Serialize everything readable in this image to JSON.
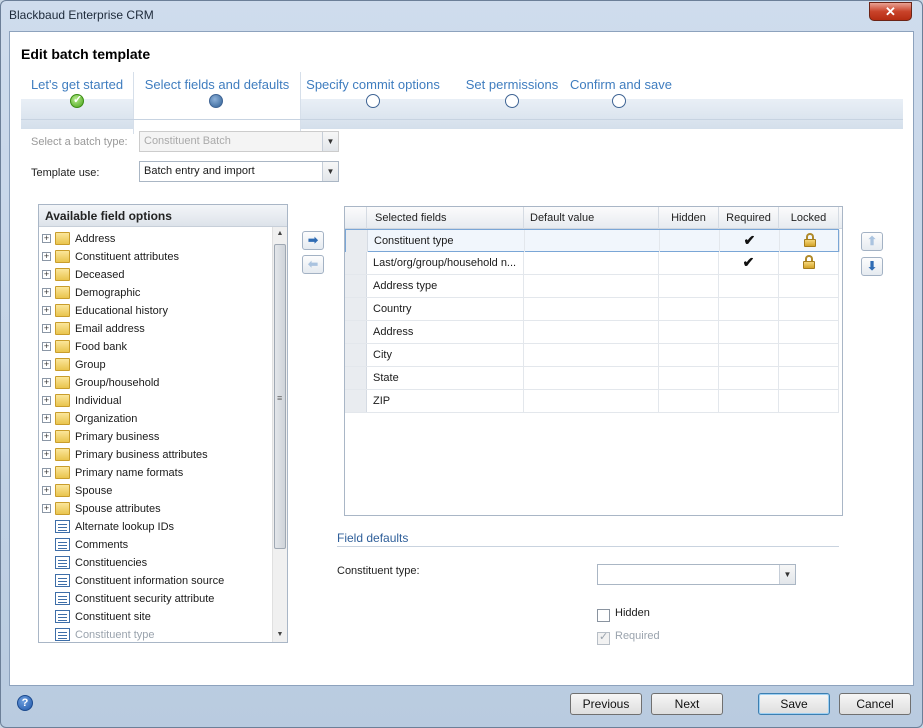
{
  "window": {
    "title": "Blackbaud Enterprise CRM",
    "close_glyph": "✕"
  },
  "page": {
    "heading": "Edit batch template"
  },
  "wizard": {
    "steps": [
      {
        "label": "Let's get started",
        "state": "done"
      },
      {
        "label": "Select fields and defaults",
        "state": "current"
      },
      {
        "label": "Specify commit options",
        "state": "pending"
      },
      {
        "label": "Set permissions",
        "state": "pending"
      },
      {
        "label": "Confirm and save",
        "state": "pending"
      }
    ]
  },
  "form": {
    "batch_type_label": "Select a batch type:",
    "batch_type_value": "Constituent Batch",
    "template_use_label": "Template use:",
    "template_use_value": "Batch entry and import"
  },
  "tree": {
    "header": "Available field options",
    "items": [
      {
        "label": "Address",
        "type": "folder"
      },
      {
        "label": "Constituent attributes",
        "type": "folder"
      },
      {
        "label": "Deceased",
        "type": "folder"
      },
      {
        "label": "Demographic",
        "type": "folder"
      },
      {
        "label": "Educational history",
        "type": "folder"
      },
      {
        "label": "Email address",
        "type": "folder"
      },
      {
        "label": "Food bank",
        "type": "folder"
      },
      {
        "label": "Group",
        "type": "folder"
      },
      {
        "label": "Group/household",
        "type": "folder"
      },
      {
        "label": "Individual",
        "type": "folder"
      },
      {
        "label": "Organization",
        "type": "folder"
      },
      {
        "label": "Primary business",
        "type": "folder"
      },
      {
        "label": "Primary business attributes",
        "type": "folder"
      },
      {
        "label": "Primary name formats",
        "type": "folder"
      },
      {
        "label": "Spouse",
        "type": "folder"
      },
      {
        "label": "Spouse attributes",
        "type": "folder"
      },
      {
        "label": "Alternate lookup IDs",
        "type": "field"
      },
      {
        "label": "Comments",
        "type": "field"
      },
      {
        "label": "Constituencies",
        "type": "field"
      },
      {
        "label": "Constituent information source",
        "type": "field"
      },
      {
        "label": "Constituent security attribute",
        "type": "field"
      },
      {
        "label": "Constituent site",
        "type": "field"
      },
      {
        "label": "Constituent type",
        "type": "field-faded"
      }
    ]
  },
  "grid": {
    "columns": [
      "Selected fields",
      "Default value",
      "Hidden",
      "Required",
      "Locked"
    ],
    "rows": [
      {
        "field": "Constituent type",
        "default": "",
        "hidden": "",
        "required": "✔",
        "locked": true
      },
      {
        "field": "Last/org/group/household n...",
        "default": "",
        "hidden": "",
        "required": "✔",
        "locked": true
      },
      {
        "field": "Address type",
        "default": "",
        "hidden": "",
        "required": "",
        "locked": false
      },
      {
        "field": "Country",
        "default": "",
        "hidden": "",
        "required": "",
        "locked": false
      },
      {
        "field": "Address",
        "default": "",
        "hidden": "",
        "required": "",
        "locked": false
      },
      {
        "field": "City",
        "default": "",
        "hidden": "",
        "required": "",
        "locked": false
      },
      {
        "field": "State",
        "default": "",
        "hidden": "",
        "required": "",
        "locked": false
      },
      {
        "field": "ZIP",
        "default": "",
        "hidden": "",
        "required": "",
        "locked": false
      }
    ]
  },
  "field_defaults": {
    "title": "Field defaults",
    "constituent_type_label": "Constituent type:",
    "constituent_type_value": "",
    "hidden_label": "Hidden",
    "required_label": "Required"
  },
  "buttons": {
    "previous": "Previous",
    "next": "Next",
    "save": "Save",
    "cancel": "Cancel",
    "help": "?"
  }
}
